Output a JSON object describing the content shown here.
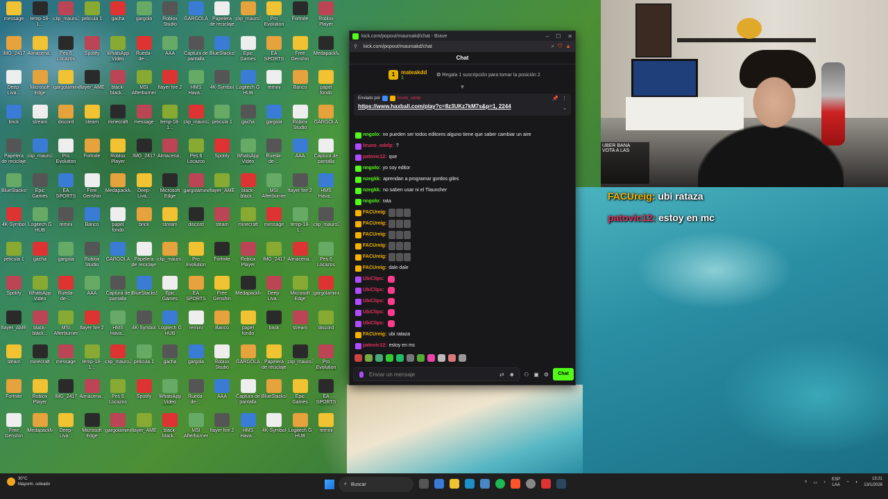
{
  "browser": {
    "window_title": "kick.com/popout/mauroakd/chat - Brave",
    "url": "kick.com/popout/mauroakd/chat",
    "chat_heading": "Chat"
  },
  "kingboard": {
    "name": "mateakdd",
    "count": "1",
    "gift_text": "Regala 1 suscripción para tomar la posición 2"
  },
  "pinned": {
    "label": "Enviado por",
    "sender": "bruno_odelp",
    "link": "https://www.haxball.com/play?c=8z3UKz7kM7s&p=1, 2244"
  },
  "messages": [
    {
      "user": "nngolo",
      "color": "#53fc18",
      "text": "no pueden ser todos editores alguno tiene que saber cambiar un aire"
    },
    {
      "user": "bruno_odelp",
      "color": "#e0305a",
      "text": "?"
    },
    {
      "user": "patovic12",
      "color": "#e0305a",
      "text": "que"
    },
    {
      "user": "nngolo",
      "color": "#53fc18",
      "text": "yo soy editor"
    },
    {
      "user": "nzegkk",
      "color": "#53fc18",
      "text": "aprendan a programar gordos giles"
    },
    {
      "user": "nzegkk",
      "color": "#53fc18",
      "text": "no saben usar ni el Tlauncher"
    },
    {
      "user": "nngolo",
      "color": "#53fc18",
      "text": "rata"
    },
    {
      "user": "FACUreig",
      "color": "#f5b400",
      "text": ""
    },
    {
      "user": "FACUreig",
      "color": "#f5b400",
      "text": ""
    },
    {
      "user": "FACUreig",
      "color": "#f5b400",
      "text": ""
    },
    {
      "user": "FACUreig",
      "color": "#f5b400",
      "text": ""
    },
    {
      "user": "FACUreig",
      "color": "#f5b400",
      "text": ""
    },
    {
      "user": "FACUreig",
      "color": "#f5b400",
      "text": "dale dale"
    },
    {
      "user": "UbiClips",
      "color": "#e0305a",
      "text": ""
    },
    {
      "user": "UbiClips",
      "color": "#e0305a",
      "text": ""
    },
    {
      "user": "UbiClips",
      "color": "#e0305a",
      "text": ""
    },
    {
      "user": "UbiClips",
      "color": "#e0305a",
      "text": ""
    },
    {
      "user": "UbiClips",
      "color": "#e0305a",
      "text": ""
    },
    {
      "user": "FACUreig",
      "color": "#f5b400",
      "text": "ubi rataza"
    },
    {
      "user": "patovic12",
      "color": "#e0305a",
      "text": "estoy en mc"
    }
  ],
  "input": {
    "placeholder": "Enviar un mensaje",
    "send_label": "Chat"
  },
  "overlay": {
    "line1_user": "FACUreig:",
    "line1_msg": "ubi rataza",
    "line2_user": "patovic12:",
    "line2_msg": "estoy en mc",
    "cam_chat_1": "UBER BANA",
    "cam_chat_2": "VOTA A LAS"
  },
  "taskbar": {
    "weather_temp": "30°C",
    "weather_desc": "Mayorm. soleado",
    "search_label": "Buscar",
    "lang": "ESP",
    "lang2": "LAA",
    "time": "13:21",
    "date": "13/1/2026"
  },
  "desktop_icons": [
    "message",
    "temp-18-1...",
    "clip_mauro2",
    "pelicula 1",
    "gacha",
    "gargola",
    "Roblox Studio",
    "GARGOLA",
    "Papelera de reciclaje",
    "clip_mauro3",
    "Pro Evolution Soccer 6",
    "Fortnite",
    "Roblox Player",
    "IMG_2417",
    "Almacena...",
    "Pes 6 Locazos",
    "Spotify",
    "WhatsApp Video 2025-...",
    "Rueda-de-...",
    "AAA",
    "Captura de pantalla",
    "BlueStacks5...",
    "Epic Games Launcher",
    "EA SPORTS FC 26",
    "Free Genshin",
    "MedapackM...",
    "Deep-Liva...",
    "Microsoft Edge",
    "gargolaminer",
    "flayer_AME",
    "black-black...",
    "MSI Afterburner",
    "flayer fire 2",
    "HMS Hava...",
    "4K-Symbol",
    "Logitech G HUB",
    "remini",
    "Banco",
    "papel fondo",
    "brick",
    "stream",
    "discord",
    "steam",
    "minecraft"
  ]
}
